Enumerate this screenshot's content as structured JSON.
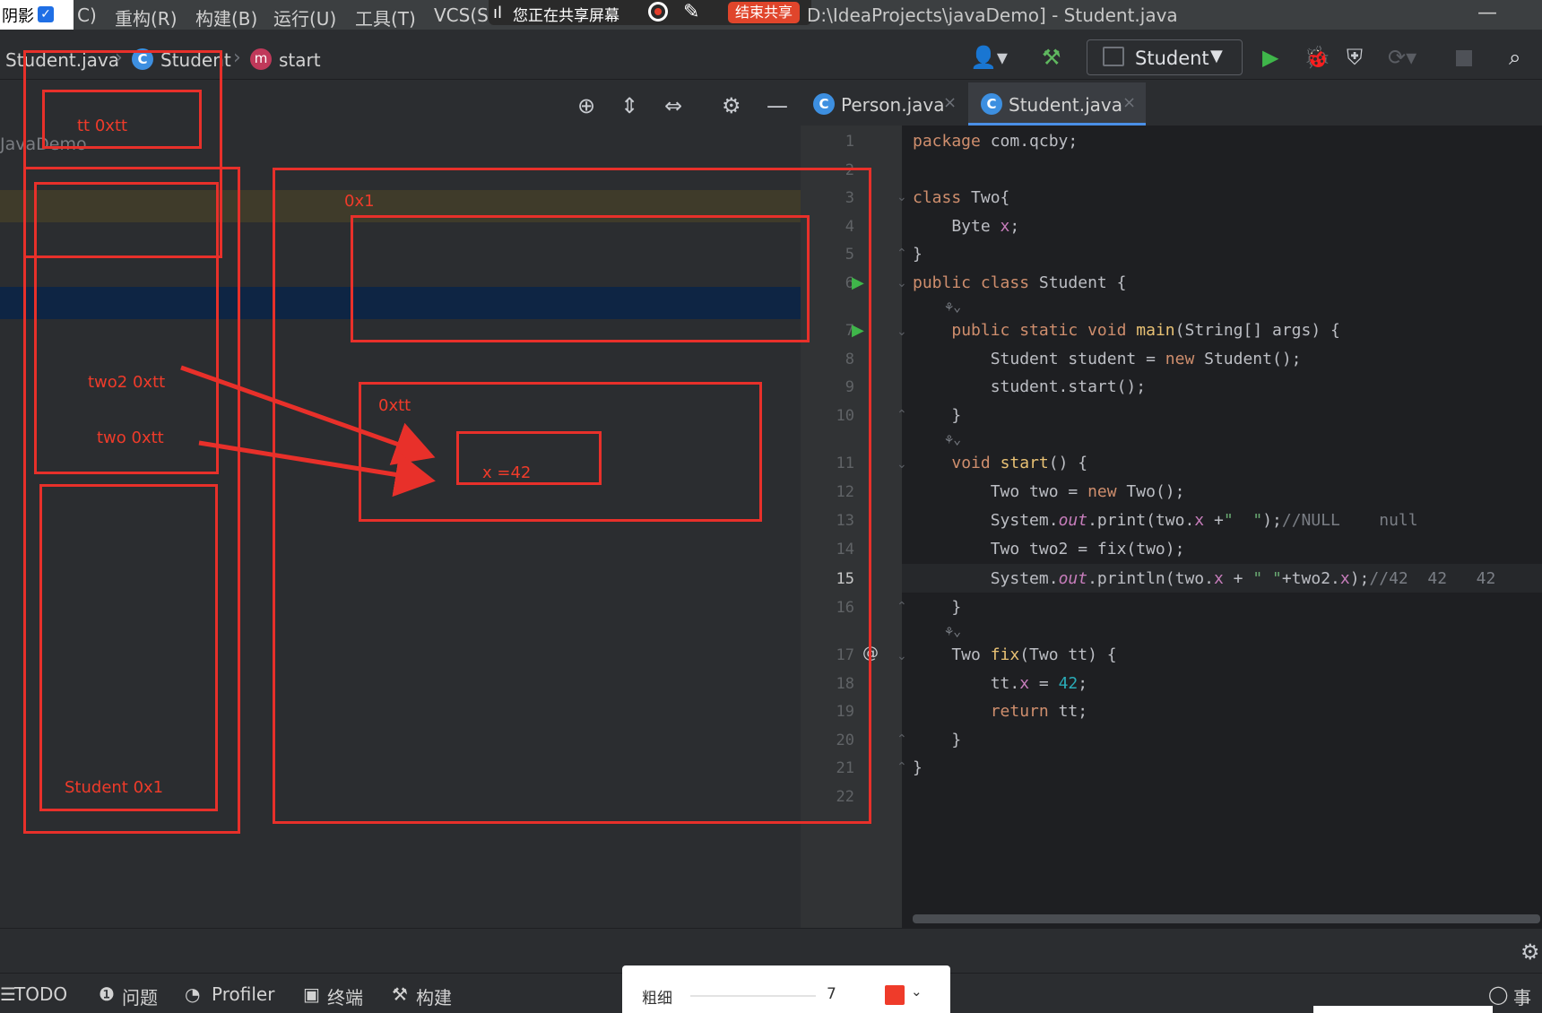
{
  "overlay": {
    "shade_label": "阴影",
    "screen_share_text": "您正在共享屏幕",
    "end_share_label": "结束共享",
    "pen": {
      "label": "粗细",
      "size": "7",
      "color": "#ef3b2a"
    }
  },
  "menubar": {
    "items": [
      "C)",
      "重构(R)",
      "构建(B)",
      "运行(U)",
      "工具(T)",
      "VCS(S"
    ],
    "window_title": "D:\\IdeaProjects\\javaDemo] - Student.java"
  },
  "breadcrumb": {
    "file": "Student.java",
    "class": "Student",
    "method": "start"
  },
  "toolbar": {
    "run_config": "Student"
  },
  "left_panel": {
    "project_label": "JavaDemo"
  },
  "tabs": [
    {
      "label": "Person.java",
      "active": false
    },
    {
      "label": "Student.java",
      "active": true
    }
  ],
  "editor": {
    "current_line": 15,
    "lines": [
      "1",
      "2",
      "3",
      "4",
      "5",
      "6",
      "7",
      "8",
      "9",
      "10",
      "11",
      "12",
      "13",
      "14",
      "15",
      "16",
      "17",
      "18",
      "19",
      "20",
      "21",
      "22"
    ]
  },
  "annotations": {
    "stack_tt": "tt  0xtt",
    "stack_two2": "two2  0xtt",
    "stack_two": "two  0xtt",
    "stack_student": "Student  0x1",
    "heap_0x1": "0x1",
    "heap_0xtt": "0xtt",
    "heap_x": "x =42",
    "color": "#e8302a"
  },
  "bottom_tools": {
    "todo": "TODO",
    "problems": "问题",
    "profiler": "Profiler",
    "terminal": "终端",
    "build": "构建",
    "events": "事件"
  }
}
